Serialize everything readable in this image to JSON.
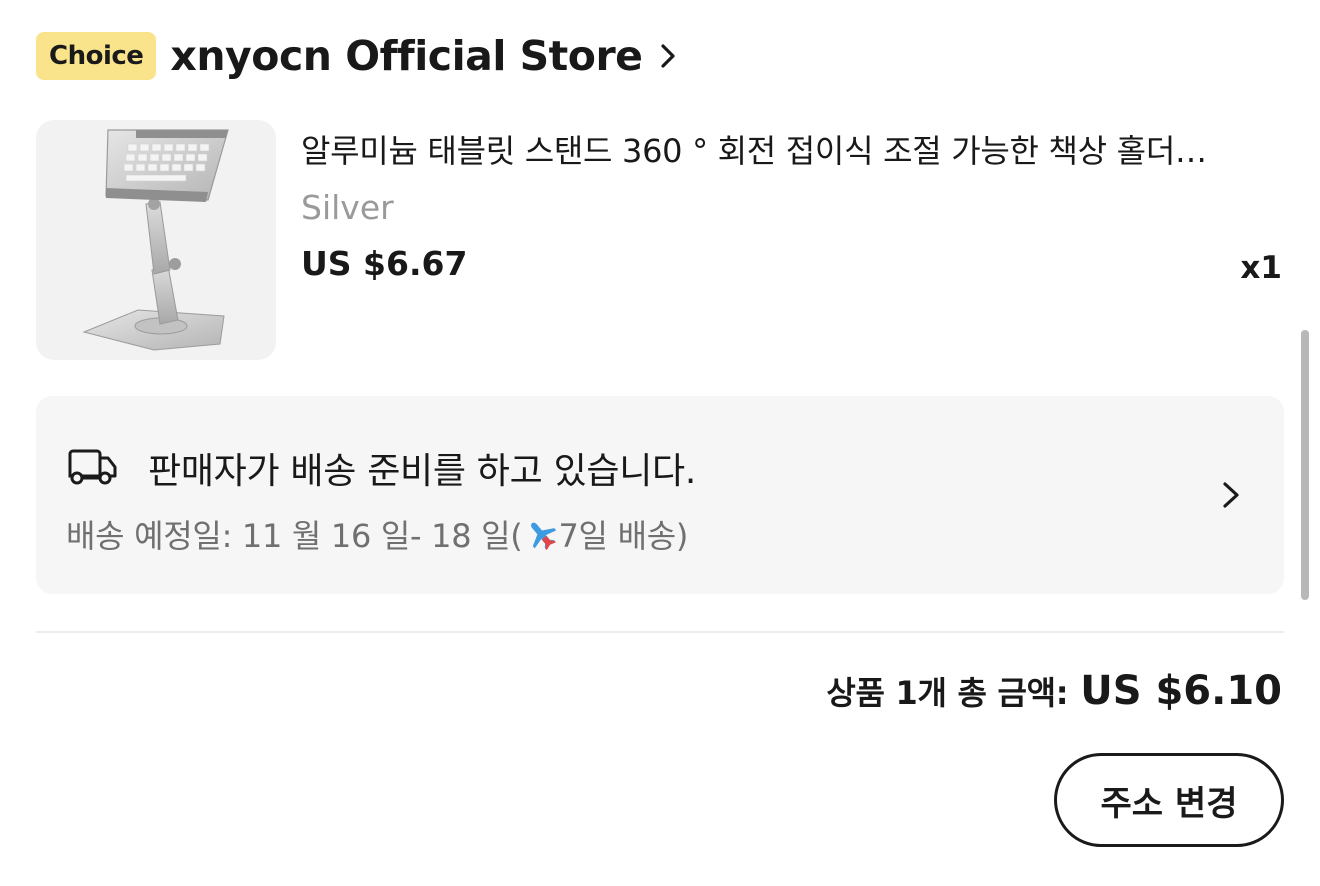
{
  "store": {
    "badge": "Choice",
    "name": "xnyocn Official Store"
  },
  "product": {
    "title": "알루미늄 태블릿 스탠드 360 ° 회전 접이식 조절 가능한 책상 홀더…",
    "variant": "Silver",
    "price": "US $6.67",
    "quantity": "x1"
  },
  "shipping": {
    "status": "판매자가 배송 준비를 하고 있습니다.",
    "eta_prefix": "배송 예정일: 11 월 16 일- 18 일(",
    "eta_suffix": "7일 배송)"
  },
  "summary": {
    "total_label": "상품 1개 총 금액:",
    "total_value": "US $6.10"
  },
  "actions": {
    "change_address": "주소 변경"
  },
  "colors": {
    "choice_badge": "#f9e38b",
    "card_background": "#f6f6f6",
    "text_primary": "#191919",
    "text_secondary": "#9a9a9a"
  },
  "icons": [
    "chevron-right-icon",
    "truck-icon",
    "airplane-icon"
  ]
}
